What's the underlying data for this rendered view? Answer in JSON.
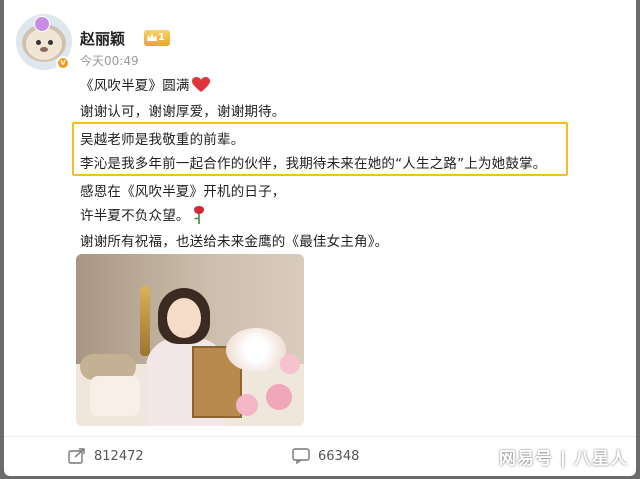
{
  "user": {
    "name": "赵丽颖",
    "level": "1",
    "verified_badge": "V",
    "time": "今天00:49"
  },
  "post": {
    "lines": [
      "《风吹半夏》圆满",
      "谢谢认可，谢谢厚爱，谢谢期待。",
      "吴越老师是我敬重的前辈。",
      "李沁是我多年前一起合作的伙伴，我期待未来在她的“人生之路”上为她鼓掌。",
      "感恩在《风吹半夏》开机的日子，",
      "许半夏不负众望。",
      "谢谢所有祝福，也送给未来金鹰的《最佳女主角》。"
    ]
  },
  "footer": {
    "reposts": "812472",
    "comments": "66348"
  },
  "watermark": "网易号 | 八星人",
  "colors": {
    "highlight_border": "#f2c01c",
    "heart": "#e0353b",
    "text": "#222222",
    "muted": "#999999"
  },
  "icons": {
    "repost": "share-icon",
    "comment": "comment-icon",
    "heart": "heart-icon",
    "rose": "rose-icon"
  }
}
